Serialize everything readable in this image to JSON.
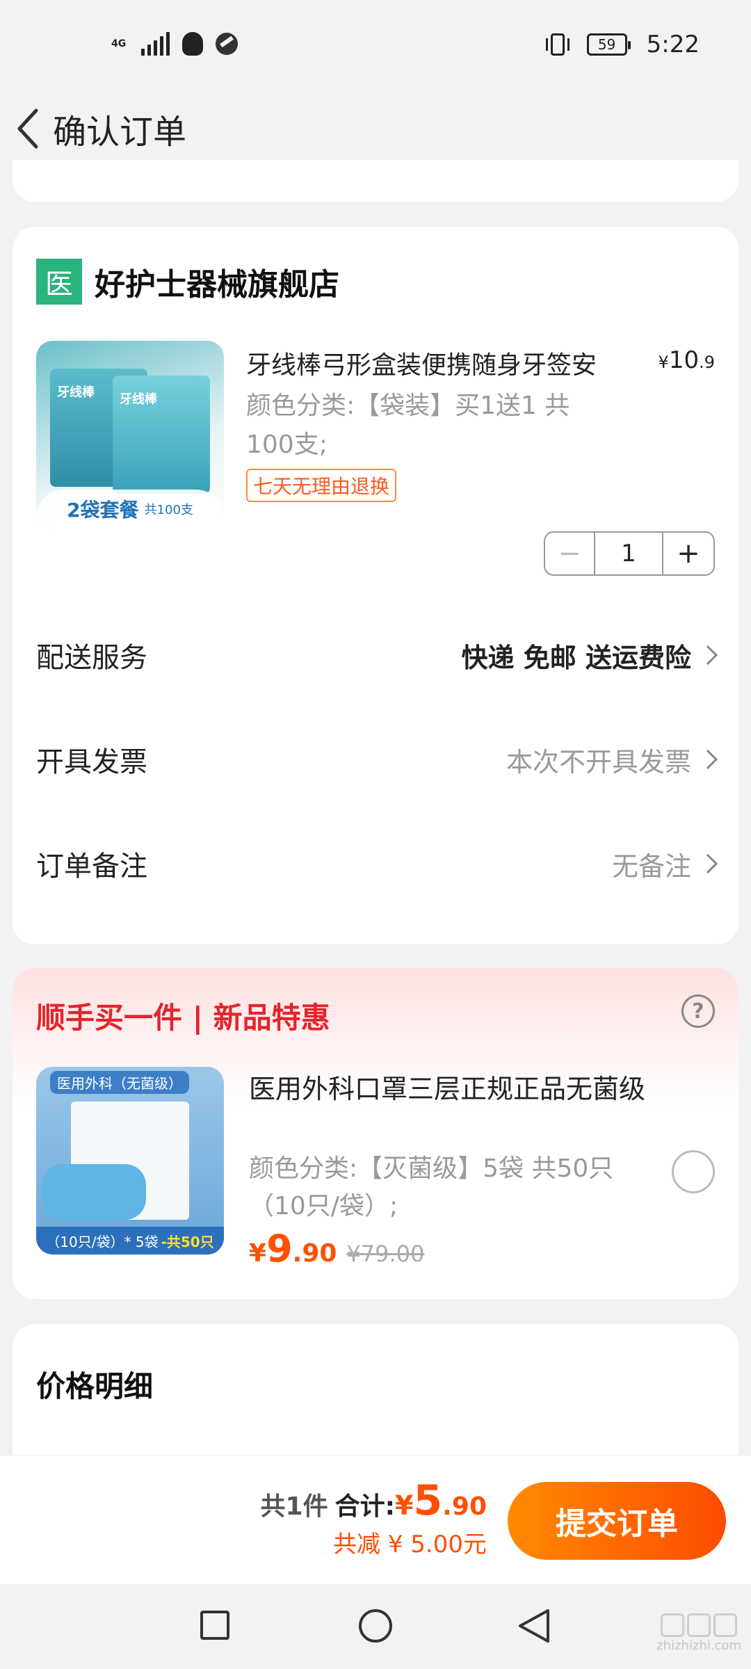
{
  "status_bar": {
    "network": "4G",
    "battery": "59",
    "time": "5:22"
  },
  "header": {
    "title": "确认订单"
  },
  "shop": {
    "logo_char": "医",
    "name": "好护士器械旗舰店",
    "product": {
      "image_text_1": "牙线棒",
      "image_text_2": "牙线棒",
      "image_band_main": "2袋套餐",
      "image_band_sub": "共100支",
      "title": "牙线棒弓形盒装便携随身牙签安",
      "price_symbol": "¥",
      "price_int": "10",
      "price_dec": ".9",
      "spec": "颜色分类:【袋装】买1送1 共100支;",
      "return_tag": "七天无理由退换",
      "quantity": "1",
      "minus": "−",
      "plus": "+"
    },
    "rows": [
      {
        "label": "配送服务",
        "value": "快递 免邮 送运费险"
      },
      {
        "label": "开具发票",
        "value": "本次不开具发票"
      },
      {
        "label": "订单备注",
        "value": "无备注"
      }
    ]
  },
  "addon": {
    "title": "顺手买一件 | 新品特惠",
    "help": "?",
    "image_top": "医用外科（无菌级）",
    "image_band_main": "（10只/袋）* 5袋",
    "image_band_sub": "-共50只",
    "name": "医用外科口罩三层正规正品无菌级",
    "spec": "颜色分类:【灭菌级】5袋 共50只（10只/袋）;",
    "price_symbol": "¥",
    "price_int": "9",
    "price_dec": ".90",
    "old_price": "¥79.00"
  },
  "price_detail": {
    "title": "价格明细"
  },
  "bottom_bar": {
    "count": "共1件",
    "total_label": "合计:",
    "total_symbol": "¥",
    "total_int": "5",
    "total_dec": ".90",
    "saved": "共减 ¥ 5.00元",
    "submit": "提交订单"
  },
  "watermark": {
    "text": "zhizhizhi.com"
  }
}
